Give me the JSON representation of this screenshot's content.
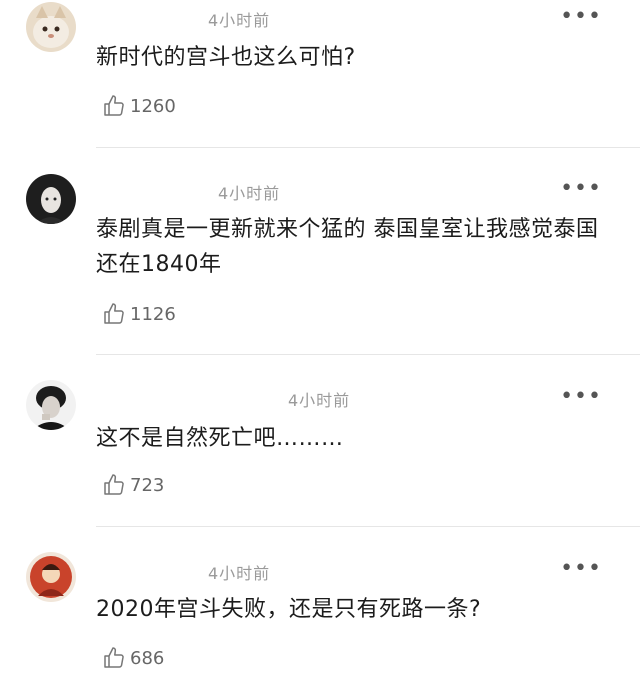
{
  "comments": [
    {
      "time": "4小时前",
      "text": "新时代的宫斗也这么可怕?",
      "likes": "1260",
      "more": "•••"
    },
    {
      "time": "4小时前",
      "text": "泰剧真是一更新就来个猛的 泰国皇室让我感觉泰国还在1840年",
      "likes": "1126",
      "more": "•••"
    },
    {
      "time": "4小时前",
      "text": "这不是自然死亡吧………",
      "likes": "723",
      "more": "•••"
    },
    {
      "time": "4小时前",
      "text": "2020年宫斗失败，还是只有死路一条?",
      "likes": "686",
      "more": "•••"
    }
  ]
}
